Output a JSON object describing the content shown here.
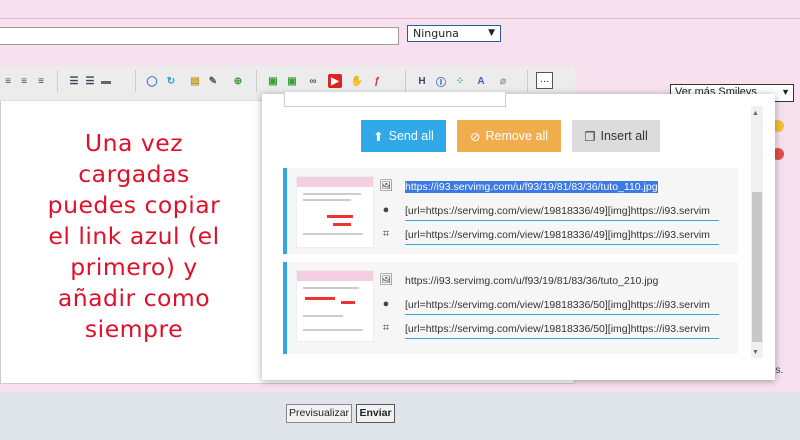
{
  "form": {
    "subject_value": "",
    "select_value": "Ninguna",
    "preview_label": "Previsualizar",
    "send_label": "Enviar"
  },
  "toolbar": {
    "buttons": [
      {
        "icon": "align-center-icon"
      },
      {
        "icon": "align-right-icon"
      },
      {
        "icon": "align-justify-icon"
      },
      {
        "icon": "unordered-list-icon"
      },
      {
        "icon": "ordered-list-icon"
      },
      {
        "icon": "horizontal-rule-icon"
      },
      {
        "icon": "comment-icon"
      },
      {
        "icon": "refresh-icon"
      },
      {
        "icon": "page-icon"
      },
      {
        "icon": "edit-icon"
      },
      {
        "icon": "add-icon"
      },
      {
        "icon": "image-icon"
      },
      {
        "icon": "upload-image-icon"
      },
      {
        "icon": "link-icon"
      },
      {
        "icon": "youtube-icon"
      },
      {
        "icon": "hand-icon"
      },
      {
        "icon": "flash-icon"
      },
      {
        "icon": "heading-icon",
        "label": "H"
      },
      {
        "icon": "font-icon"
      },
      {
        "icon": "color-icon"
      },
      {
        "icon": "font-size-icon",
        "label": "A"
      },
      {
        "icon": "clear-format-icon"
      }
    ],
    "more_label": "…"
  },
  "annotation": {
    "lines": [
      "Una vez",
      "cargadas",
      "puedes copiar",
      "el link azul (el",
      "primero) y",
      "añadir como",
      "siempre"
    ],
    "color": "#e0102a"
  },
  "sidebar": {
    "smileys_label": "Ver más Smileys",
    "truncated_text": "os."
  },
  "uploader": {
    "send_all": "Send all",
    "remove_all": "Remove all",
    "insert_all": "Insert all",
    "accent": "#30a9e9",
    "images": [
      {
        "direct_link": "https://i93.servimg.com/u/f93/19/81/83/36/tuto_110.jpg",
        "bbcode_link": "[url=https://servimg.com/view/19818336/49][img]https://i93.servim",
        "bbcode_thumb": "[url=https://servimg.com/view/19818336/49][img]https://i93.servim"
      },
      {
        "direct_link": "https://i93.servimg.com/u/f93/19/81/83/36/tuto_210.jpg",
        "bbcode_link": "[url=https://servimg.com/view/19818336/50][img]https://i93.servim",
        "bbcode_thumb": "[url=https://servimg.com/view/19818336/50][img]https://i93.servim"
      }
    ]
  }
}
